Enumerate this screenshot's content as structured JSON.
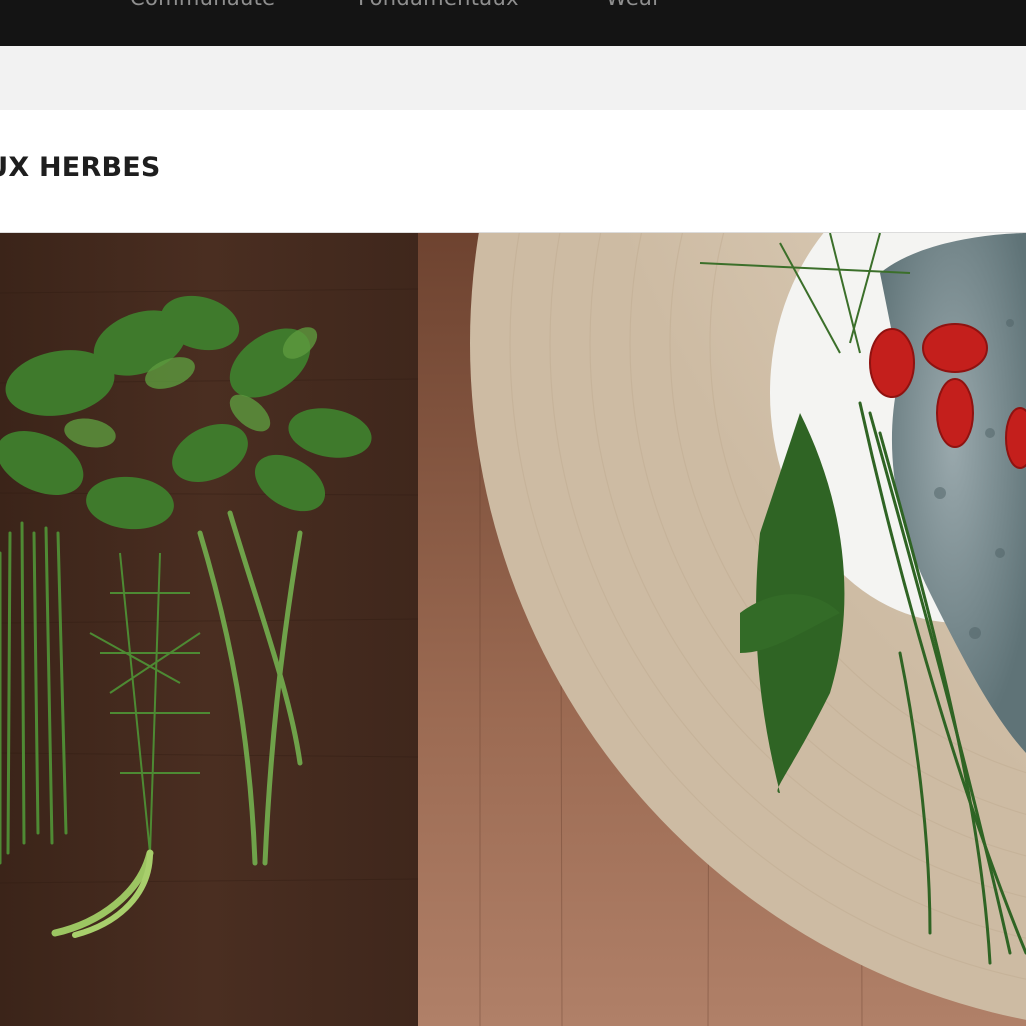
{
  "nav": {
    "items": [
      "Communauté",
      "Fondamentaux",
      "Wear"
    ]
  },
  "page": {
    "title": "AUX HERBES"
  },
  "hero": {
    "left_photo": "herbs-on-wood-photo",
    "right_photo": "herb-dip-on-bamboo-plate-photo"
  },
  "colors": {
    "nav_bg": "#141414",
    "nav_text": "#8f8f8f",
    "subbar_bg": "#f2f2f2",
    "title_text": "#1e1e1e"
  }
}
